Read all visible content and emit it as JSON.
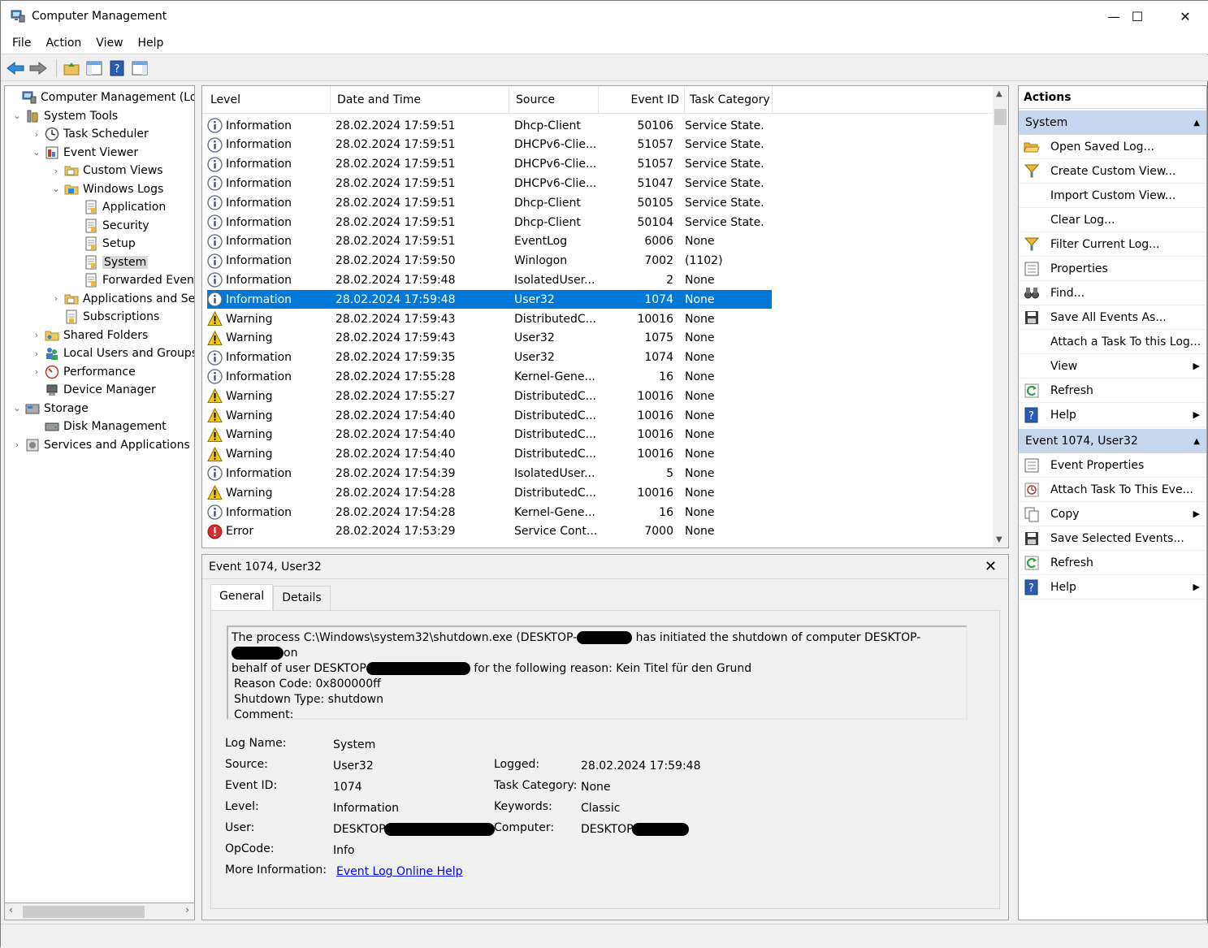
{
  "window": {
    "title": "Computer Management",
    "minimize": "—",
    "maximize": "☐",
    "close": "✕"
  },
  "menu": [
    "File",
    "Action",
    "View",
    "Help"
  ],
  "tree": [
    {
      "label": "Computer Management (Local)",
      "icon": "computer-icon",
      "level": 0,
      "arrow": ""
    },
    {
      "label": "System Tools",
      "icon": "tools-icon",
      "level": 1,
      "arrow": "v"
    },
    {
      "label": "Task Scheduler",
      "icon": "clock-icon",
      "level": 2,
      "arrow": ">"
    },
    {
      "label": "Event Viewer",
      "icon": "event-viewer-icon",
      "level": 2,
      "arrow": "v"
    },
    {
      "label": "Custom Views",
      "icon": "folder-icon",
      "level": 3,
      "arrow": ">"
    },
    {
      "label": "Windows Logs",
      "icon": "log-folder-icon",
      "level": 3,
      "arrow": "v"
    },
    {
      "label": "Application",
      "icon": "log-icon",
      "level": 4,
      "arrow": ""
    },
    {
      "label": "Security",
      "icon": "log-icon",
      "level": 4,
      "arrow": ""
    },
    {
      "label": "Setup",
      "icon": "log-icon",
      "level": 4,
      "arrow": ""
    },
    {
      "label": "System",
      "icon": "log-icon",
      "level": 4,
      "arrow": "",
      "selected": true
    },
    {
      "label": "Forwarded Events",
      "icon": "log-icon",
      "level": 4,
      "arrow": ""
    },
    {
      "label": "Applications and Services Logs",
      "icon": "folder-icon",
      "level": 3,
      "arrow": ">"
    },
    {
      "label": "Subscriptions",
      "icon": "subscription-icon",
      "level": 3,
      "arrow": ""
    },
    {
      "label": "Shared Folders",
      "icon": "shared-folder-icon",
      "level": 2,
      "arrow": ">"
    },
    {
      "label": "Local Users and Groups",
      "icon": "users-icon",
      "level": 2,
      "arrow": ">"
    },
    {
      "label": "Performance",
      "icon": "performance-icon",
      "level": 2,
      "arrow": ">"
    },
    {
      "label": "Device Manager",
      "icon": "device-manager-icon",
      "level": 2,
      "arrow": ""
    },
    {
      "label": "Storage",
      "icon": "storage-icon",
      "level": 1,
      "arrow": "v"
    },
    {
      "label": "Disk Management",
      "icon": "disk-icon",
      "level": 2,
      "arrow": ""
    },
    {
      "label": "Services and Applications",
      "icon": "services-icon",
      "level": 1,
      "arrow": ">"
    }
  ],
  "list": {
    "columns": [
      "Level",
      "Date and Time",
      "Source",
      "Event ID",
      "Task Category"
    ],
    "rows": [
      {
        "level": "Information",
        "date": "28.02.2024 17:59:51",
        "source": "Dhcp-Client",
        "id": "50106",
        "cat": "Service State..."
      },
      {
        "level": "Information",
        "date": "28.02.2024 17:59:51",
        "source": "DHCPv6-Clie...",
        "id": "51057",
        "cat": "Service State..."
      },
      {
        "level": "Information",
        "date": "28.02.2024 17:59:51",
        "source": "DHCPv6-Clie...",
        "id": "51057",
        "cat": "Service State..."
      },
      {
        "level": "Information",
        "date": "28.02.2024 17:59:51",
        "source": "DHCPv6-Clie...",
        "id": "51047",
        "cat": "Service State..."
      },
      {
        "level": "Information",
        "date": "28.02.2024 17:59:51",
        "source": "Dhcp-Client",
        "id": "50105",
        "cat": "Service State..."
      },
      {
        "level": "Information",
        "date": "28.02.2024 17:59:51",
        "source": "Dhcp-Client",
        "id": "50104",
        "cat": "Service State..."
      },
      {
        "level": "Information",
        "date": "28.02.2024 17:59:51",
        "source": "EventLog",
        "id": "6006",
        "cat": "None"
      },
      {
        "level": "Information",
        "date": "28.02.2024 17:59:50",
        "source": "Winlogon",
        "id": "7002",
        "cat": "(1102)"
      },
      {
        "level": "Information",
        "date": "28.02.2024 17:59:48",
        "source": "IsolatedUser...",
        "id": "2",
        "cat": "None"
      },
      {
        "level": "Information",
        "date": "28.02.2024 17:59:48",
        "source": "User32",
        "id": "1074",
        "cat": "None",
        "selected": true
      },
      {
        "level": "Warning",
        "date": "28.02.2024 17:59:43",
        "source": "DistributedC...",
        "id": "10016",
        "cat": "None"
      },
      {
        "level": "Warning",
        "date": "28.02.2024 17:59:43",
        "source": "User32",
        "id": "1075",
        "cat": "None"
      },
      {
        "level": "Information",
        "date": "28.02.2024 17:59:35",
        "source": "User32",
        "id": "1074",
        "cat": "None"
      },
      {
        "level": "Information",
        "date": "28.02.2024 17:55:28",
        "source": "Kernel-Gene...",
        "id": "16",
        "cat": "None"
      },
      {
        "level": "Warning",
        "date": "28.02.2024 17:55:27",
        "source": "DistributedC...",
        "id": "10016",
        "cat": "None"
      },
      {
        "level": "Warning",
        "date": "28.02.2024 17:54:40",
        "source": "DistributedC...",
        "id": "10016",
        "cat": "None"
      },
      {
        "level": "Warning",
        "date": "28.02.2024 17:54:40",
        "source": "DistributedC...",
        "id": "10016",
        "cat": "None"
      },
      {
        "level": "Warning",
        "date": "28.02.2024 17:54:40",
        "source": "DistributedC...",
        "id": "10016",
        "cat": "None"
      },
      {
        "level": "Information",
        "date": "28.02.2024 17:54:39",
        "source": "IsolatedUser...",
        "id": "5",
        "cat": "None"
      },
      {
        "level": "Warning",
        "date": "28.02.2024 17:54:28",
        "source": "DistributedC...",
        "id": "10016",
        "cat": "None"
      },
      {
        "level": "Information",
        "date": "28.02.2024 17:54:28",
        "source": "Kernel-Gene...",
        "id": "16",
        "cat": "None"
      },
      {
        "level": "Error",
        "date": "28.02.2024 17:53:29",
        "source": "Service Cont...",
        "id": "7000",
        "cat": "None"
      }
    ]
  },
  "detail": {
    "header": "Event 1074, User32",
    "close": "✕",
    "tabs": [
      "General",
      "Details"
    ],
    "message": {
      "l1a": "The process C:\\Windows\\system32\\shutdown.exe (DESKTOP-",
      "l1b": "has initiated the shutdown of computer DESKTOP-",
      "l1c": "on",
      "l2a": "behalf of user DESKTOP",
      "l2b": "for the following reason: Kein Titel für den Grund",
      "l3": "Reason Code: 0x800000ff",
      "l4": "Shutdown Type: shutdown",
      "l5": "Comment:"
    },
    "props": {
      "log_name_label": "Log Name:",
      "log_name": "System",
      "source_label": "Source:",
      "source": "User32",
      "logged_label": "Logged:",
      "logged": "28.02.2024 17:59:48",
      "event_id_label": "Event ID:",
      "event_id": "1074",
      "task_category_label": "Task Category:",
      "task_category": "None",
      "level_label": "Level:",
      "level": "Information",
      "keywords_label": "Keywords:",
      "keywords": "Classic",
      "user_label": "User:",
      "user": "DESKTOP",
      "computer_label": "Computer:",
      "computer": "DESKTOP-",
      "opcode_label": "OpCode:",
      "opcode": "Info",
      "more_info_label": "More Information:",
      "more_info_link": "Event Log Online Help"
    }
  },
  "actions": {
    "title": "Actions",
    "section1": "System",
    "items1": [
      {
        "label": "Open Saved Log...",
        "icon": "open-folder-icon"
      },
      {
        "label": "Create Custom View...",
        "icon": "filter-icon"
      },
      {
        "label": "Import Custom View...",
        "icon": ""
      },
      {
        "label": "Clear Log...",
        "icon": ""
      },
      {
        "label": "Filter Current Log...",
        "icon": "filter-icon"
      },
      {
        "label": "Properties",
        "icon": "properties-icon"
      },
      {
        "label": "Find...",
        "icon": "binoculars-icon"
      },
      {
        "label": "Save All Events As...",
        "icon": "save-icon"
      },
      {
        "label": "Attach a Task To this Log...",
        "icon": ""
      },
      {
        "label": "View",
        "icon": "",
        "submenu": true
      },
      {
        "label": "Refresh",
        "icon": "refresh-icon"
      },
      {
        "label": "Help",
        "icon": "help-icon",
        "submenu": true
      }
    ],
    "section2": "Event 1074, User32",
    "items2": [
      {
        "label": "Event Properties",
        "icon": "properties-icon"
      },
      {
        "label": "Attach Task To This Eve...",
        "icon": "task-icon"
      },
      {
        "label": "Copy",
        "icon": "copy-icon",
        "submenu": true
      },
      {
        "label": "Save Selected Events...",
        "icon": "save-icon"
      },
      {
        "label": "Refresh",
        "icon": "refresh-icon"
      },
      {
        "label": "Help",
        "icon": "help-icon",
        "submenu": true
      }
    ]
  }
}
